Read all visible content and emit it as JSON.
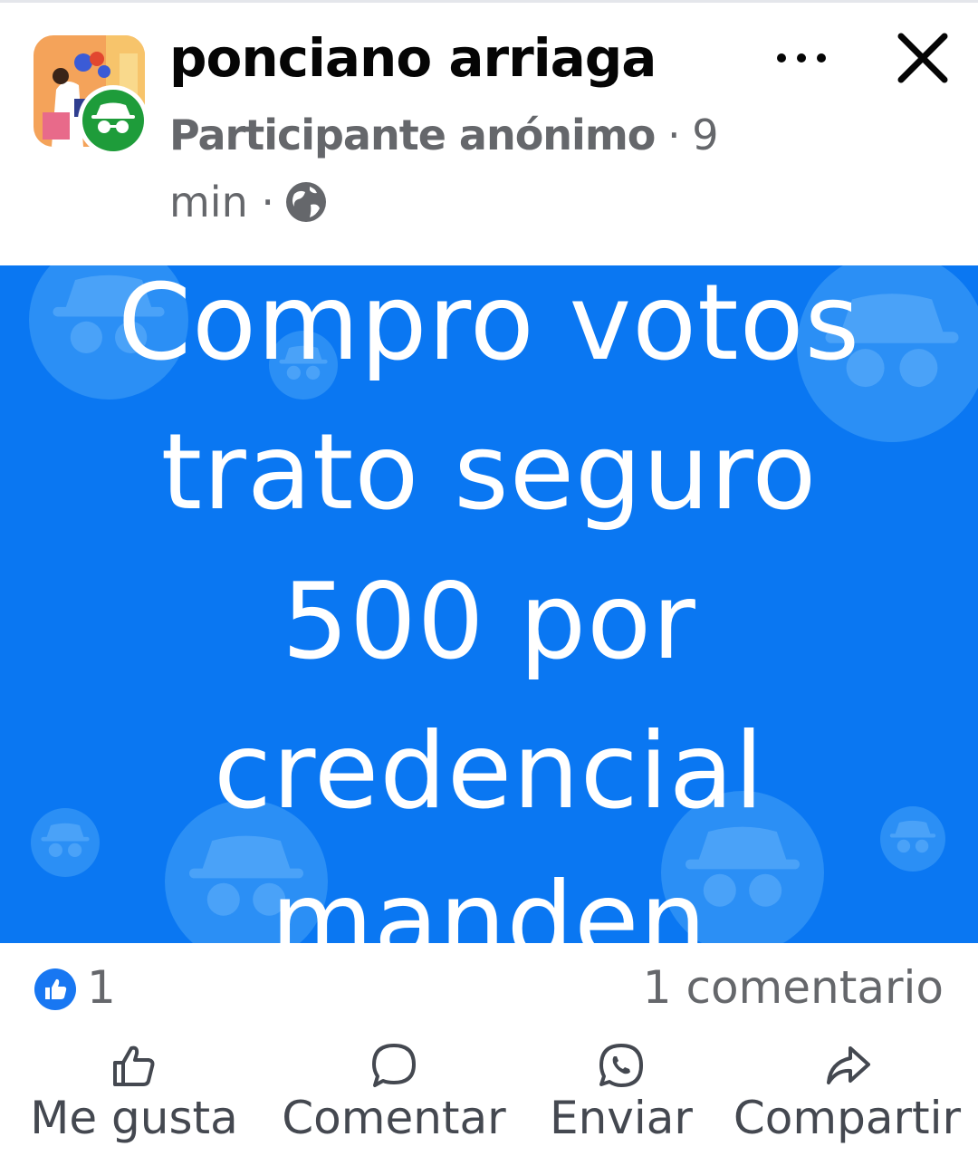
{
  "post": {
    "author": "ponciano arriaga",
    "role": "Participante anónimo",
    "time_part1": "· 9",
    "time_part2": "min ·",
    "message_lines": [
      "Compro votos",
      "trato seguro",
      "500 por",
      "credencial",
      "manden"
    ]
  },
  "icons": {
    "avatar": "illustrated-avatar",
    "badge": "anonymous-incognito-icon",
    "privacy": "globe-icon",
    "more": "more-dots-icon",
    "close": "close-icon",
    "like_reaction": "thumbs-up-reaction-icon"
  },
  "stats": {
    "likes": "1",
    "comments": "1 comentario"
  },
  "actions": {
    "like": "Me gusta",
    "comment": "Comentar",
    "send": "Enviar",
    "share": "Compartir"
  },
  "colors": {
    "post_background": "#0a77f2",
    "anon_badge": "#1e9c3a",
    "like_badge": "#1877f2"
  }
}
